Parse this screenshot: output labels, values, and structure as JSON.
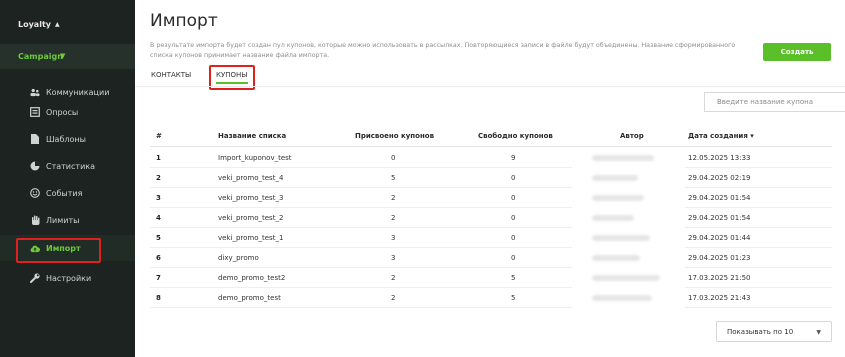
{
  "sidebar": {
    "loyalty": "Loyalty",
    "campaign": "Campaign",
    "items": [
      {
        "label": "Коммуникации",
        "icon": "people-icon"
      },
      {
        "label": "Опросы",
        "icon": "poll-icon"
      },
      {
        "label": "Шаблоны",
        "icon": "document-icon"
      },
      {
        "label": "Статистика",
        "icon": "pie-chart-icon"
      },
      {
        "label": "События",
        "icon": "smiley-icon"
      },
      {
        "label": "Лимиты",
        "icon": "hand-icon"
      },
      {
        "label": "Импорт",
        "icon": "cloud-upload-icon"
      },
      {
        "label": "Настройки",
        "icon": "wrench-icon"
      }
    ]
  },
  "header": {
    "title": "Импорт",
    "description": "В результате импорта будет создан пул купонов, которые можно использовать в рассылках. Повторяющиеся записи в файле будут объединены. Название сформированного списка купонов принимает название файла импорта.",
    "create_label": "Создать"
  },
  "tabs": [
    "КОНТАКТЫ",
    "КУПОНЫ"
  ],
  "search": {
    "placeholder": "Введите название купона"
  },
  "table": {
    "headers": [
      "#",
      "Название списка",
      "Присвоено купонов",
      "Свободно купонов",
      "Автор",
      "Дата создания ▾"
    ],
    "rows": [
      {
        "num": "1",
        "name": "Import_kuponov_test",
        "assigned": "0",
        "free": "9",
        "date": "12.05.2025 13:33"
      },
      {
        "num": "2",
        "name": "veki_promo_test_4",
        "assigned": "5",
        "free": "0",
        "date": "29.04.2025 02:19"
      },
      {
        "num": "3",
        "name": "veki_promo_test_3",
        "assigned": "2",
        "free": "0",
        "date": "29.04.2025 01:54"
      },
      {
        "num": "4",
        "name": "veki_promo_test_2",
        "assigned": "2",
        "free": "0",
        "date": "29.04.2025 01:54"
      },
      {
        "num": "5",
        "name": "veki_promo_test_1",
        "assigned": "3",
        "free": "0",
        "date": "29.04.2025 01:44"
      },
      {
        "num": "6",
        "name": "dixy_promo",
        "assigned": "3",
        "free": "0",
        "date": "29.04.2025 01:23"
      },
      {
        "num": "7",
        "name": "demo_promo_test2",
        "assigned": "2",
        "free": "5",
        "date": "17.03.2025 21:50"
      },
      {
        "num": "8",
        "name": "demo_promo_test",
        "assigned": "2",
        "free": "5",
        "date": "17.03.2025 21:43"
      }
    ]
  },
  "pager": {
    "label": "Показывать по 10"
  },
  "colors": {
    "accent": "#5bbf2a",
    "sidebar_bg": "#1d2321",
    "highlight": "#e01f1f"
  }
}
